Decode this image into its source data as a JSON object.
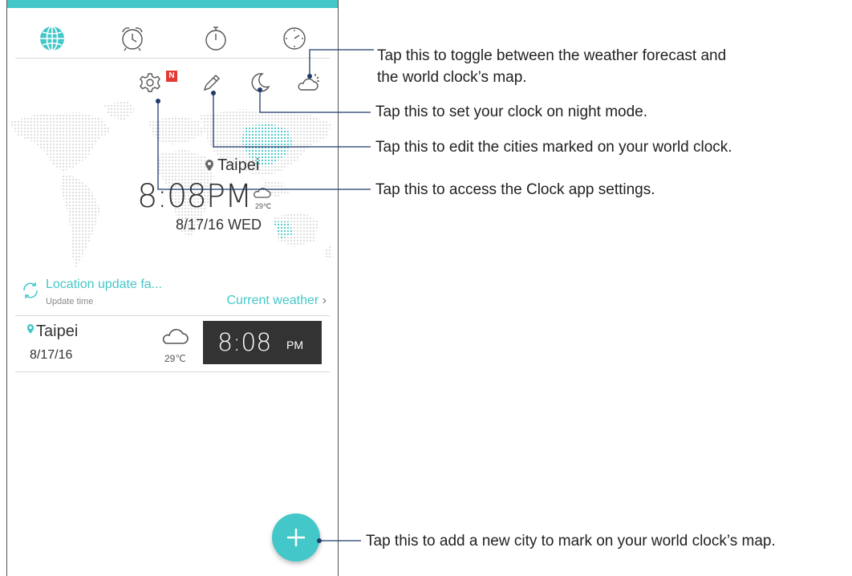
{
  "tabs": [
    {
      "name": "world-clock",
      "icon": "globe-icon"
    },
    {
      "name": "alarm",
      "icon": "alarm-clock-icon"
    },
    {
      "name": "stopwatch",
      "icon": "stopwatch-icon"
    },
    {
      "name": "timer",
      "icon": "timer-icon"
    }
  ],
  "toolbar": {
    "settings_icon": "gear-icon",
    "new_badge": "N",
    "edit_icon": "pencil-icon",
    "night_icon": "moon-icon",
    "weather_icon": "cloud-sun-icon"
  },
  "hero": {
    "city": "Taipei",
    "time": "8:08PM",
    "temp": "29℃",
    "date": "8/17/16 WED"
  },
  "location": {
    "status": "Location update fa...",
    "update_time_label": "Update time",
    "current_weather": "Current weather"
  },
  "city_row": {
    "city": "Taipei",
    "date": "8/17/16",
    "temp": "29℃",
    "time": "8:08",
    "ampm": "PM"
  },
  "callouts": {
    "weather_toggle_line1": "Tap this to toggle between the weather forecast and",
    "weather_toggle_line2": "the world clock’s map.",
    "night_mode": "Tap this to set your clock on night mode.",
    "edit_cities": "Tap this to edit the cities marked on your world clock.",
    "settings": "Tap this to access the Clock app settings.",
    "add_city": "Tap this to add a new city to mark on your world clock’s map."
  },
  "colors": {
    "accent": "#44c7c8",
    "badge": "#e53935",
    "dark_box": "#333333"
  }
}
